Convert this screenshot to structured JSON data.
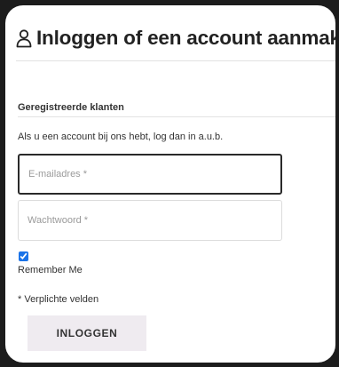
{
  "header": {
    "icon": "user-icon",
    "title": "Inloggen of een account aanmaken"
  },
  "login": {
    "section_title": "Geregistreerde klanten",
    "intro": "Als u een account bij ons hebt, log dan in a.u.b.",
    "email_placeholder": "E-mailadres *",
    "email_value": "",
    "password_placeholder": "Wachtwoord *",
    "password_value": "",
    "remember_checked": true,
    "remember_label": "Remember Me",
    "required_note": "* Verplichte velden",
    "button_label": "INLOGGEN"
  },
  "colors": {
    "background": "#1c1c1c",
    "card": "#ffffff",
    "button_bg": "#efebf0",
    "focus_border": "#2a2a2a",
    "checkbox": "#1a73e8"
  }
}
